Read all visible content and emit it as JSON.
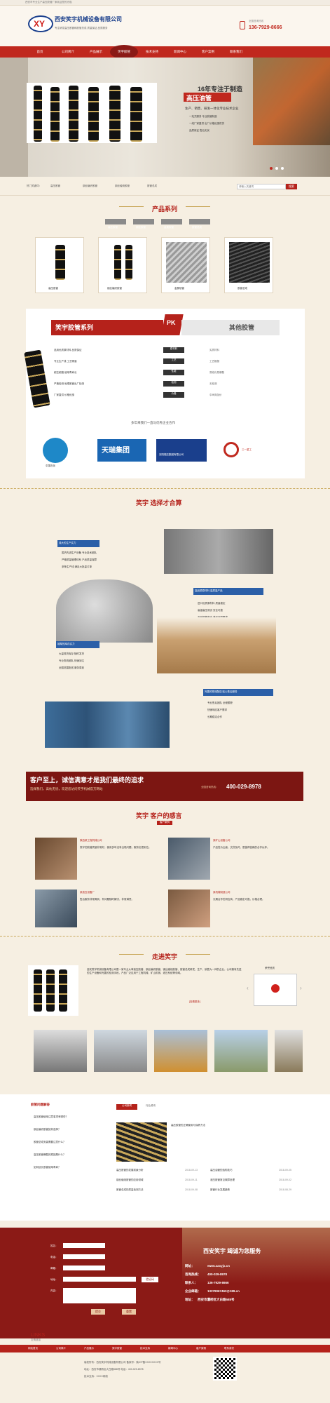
{
  "topbar": {
    "left_text": "西安市专业生产高压胶管厂家欢迎您的光临"
  },
  "header": {
    "company_name": "西安笑宇机械设备有限公司",
    "slogan": "专注研发高压胶管和胶管总成 质量保证 品质服务",
    "logo_text": "XY",
    "hotline_label": "全国咨询热线",
    "hotline": "136-7929-8666"
  },
  "nav": {
    "items": [
      "首页",
      "公司简介",
      "产品展示",
      "笑宇胶管",
      "技术支持",
      "新闻中心",
      "客户案例",
      "联系我们"
    ]
  },
  "banner": {
    "headline": "16年专注于制造",
    "highlight": "高压油管",
    "sub": "生产、销售、研发一体化专业技术企业",
    "bullets": [
      "一站式服务 专业胶管制造",
      "一线厂家直供 出厂价格优惠供货",
      "品质保证 售后无忧"
    ]
  },
  "search": {
    "hot_label": "热门关键词：",
    "keywords": [
      "高压胶管",
      "钢丝编织胶管",
      "钢丝缠绕胶管",
      "胶管总成"
    ],
    "placeholder": "请输入关键词",
    "button": "搜索"
  },
  "products": {
    "title": "产品系列",
    "tabs": [
      "高压胶管",
      "钢丝胶管",
      "金属软管",
      "胶管总成"
    ],
    "items": [
      "高压胶管",
      "钢丝编织胶管",
      "金属软管",
      "胶管总成"
    ]
  },
  "pk": {
    "left_title": "笑宇胶管系列",
    "right_title": "其他胶管",
    "badge": "PK",
    "left_rows": [
      "选用优质原材料 品质保证",
      "专业生产线 工艺精湛",
      "耐压耐磨 使用寿命长",
      "严格检测 每根胶管出厂检测",
      "厂家直供 价格优惠"
    ],
    "mid_rows": [
      "原材料",
      "工艺",
      "性能",
      "检测",
      "价格"
    ],
    "right_rows": [
      "劣质材料",
      "工艺粗糙",
      "易老化易爆裂",
      "无检测",
      "中间商加价"
    ],
    "partners_title": "多年来我们一直与优秀企业合作",
    "partners": [
      "中国石化",
      "天瑞集团",
      "安阳锻压集团有限公司",
      "三一重工"
    ]
  },
  "why": {
    "title": "笑宇 选择才合算",
    "blocks": [
      {
        "title": "强大的生产实力",
        "lines": [
          "国内先进生产设备 专业技术团队",
          "严格质量管理体系 产品质量保障",
          "多条生产线 满足大批量订单"
        ]
      },
      {
        "title": "高品质原材料 高质量产品",
        "lines": [
          "进口优质原材料 质量稳定",
          "高温高压测试 安全可靠",
          "产品规格齐全 满足不同需求"
        ]
      },
      {
        "title": "雄厚的库存实力",
        "lines": [
          "大量现货库存 随时发货",
          "专业物流团队 快速到达",
          "全国范围配送 服务周到"
        ]
      },
      {
        "title": "完善的物流配送 贴心售后服务",
        "lines": [
          "专业售后团队 全程跟踪",
          "快速响应客户需求",
          "长期稳定合作"
        ]
      }
    ]
  },
  "promo": {
    "headline": "客户至上，诚信满意才是我们最终的追求",
    "sub": "选择我们，高枕无忧，欢迎您访问笑宇机械官方网站",
    "phone_label": "全国咨询热线：",
    "phone": "400-029-8978"
  },
  "testimonials": {
    "title": "笑宇 客户的感言",
    "tag": "客户案例",
    "items": [
      {
        "name": "陕西某工程机械公司",
        "text": "笑宇的胶管质量非常好，使用多年没有出现问题，服务也很到位。"
      },
      {
        "name": "某矿山设备公司",
        "text": "产品性价比高，交货及时，是值得信赖的合作伙伴。"
      },
      {
        "name": "某液压设备厂",
        "text": "售后服务非常周到，有问题随时解决，非常满意。"
      },
      {
        "name": "某机械制造公司",
        "text": "长期合作的供应商，产品稳定可靠，价格合理。"
      }
    ]
  },
  "about": {
    "title": "走进笑宇",
    "text": "西安笑宇机械设备有限公司是一家专业从事高压胶管、钢丝编织胶管、钢丝缠绕胶管、胶管总成研发、生产、销售为一体的企业。公司拥有先进的生产设备和完善的检测手段，产品广泛应用于工程机械、矿山机械、液压系统等领域。",
    "more": "[查看更多]",
    "cert_title": "荣誉资质"
  },
  "news": {
    "left_title": "胶管问题解答",
    "tabs": [
      "公司新闻",
      "行业资讯"
    ],
    "faq": [
      "高压胶管使用注意事项有哪些？",
      "钢丝编织胶管如何选择？",
      "胶管总成安装需要注意什么？",
      "高压胶管爆裂的原因是什么？",
      "如何延长胶管使用寿命？"
    ],
    "feature_title": "高压胶管的正确使用与保养方法",
    "list": [
      "高压胶管的发展前景分析",
      "钢丝缠绕胶管的应用领域",
      "胶管总成的质量检测方法",
      "高压油管的选购技巧",
      "液压胶管常见故障处理",
      "胶管行业发展趋势"
    ],
    "dates": [
      "2018-09-13",
      "2018-09-11",
      "2018-09-08",
      "2018-09-05",
      "2018-09-02",
      "2018-08-29"
    ]
  },
  "contact": {
    "form_labels": [
      "姓名：",
      "电话：",
      "邮箱：",
      "地址：",
      "内容："
    ],
    "code_label": "验证码",
    "submit": "提交",
    "reset": "重置",
    "title": "西安笑宇 竭诚为您服务",
    "site_label": "网址：",
    "site": "www.xaxyjx.cn",
    "tel_label": "咨询热线：",
    "tel": "400-029-8978",
    "person_label": "联系人：",
    "person": "136-7929-8666",
    "mobile_label": "企业邮箱：",
    "mobile": "13379067462@189.cn",
    "addr_label": "地址：",
    "addr": "西安市灞桥区大白路588号"
  },
  "links": {
    "title": "LINKS",
    "sub": "友情链接"
  },
  "footer_nav": [
    "网站首页",
    "公司简介",
    "产品展示",
    "笑宇胶管",
    "技术支持",
    "新闻中心",
    "客户案例",
    "联系我们"
  ],
  "copyright": [
    "版权所有：西安笑宇机械设备有限公司 备案号：陕ICP备XXXXXXXX号",
    "地址：西安市灞桥区大白路588号 电话：400-029-8978",
    "技术支持：XXXX网络"
  ]
}
